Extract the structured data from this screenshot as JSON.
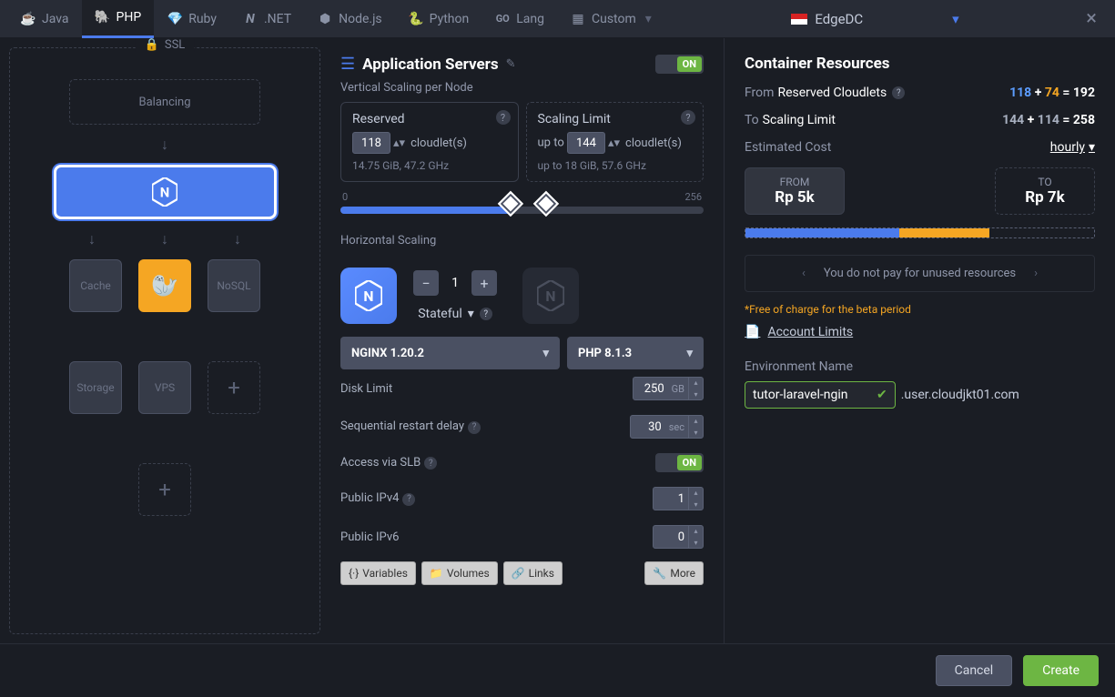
{
  "tabs": {
    "java": "Java",
    "php": "PHP",
    "ruby": "Ruby",
    "dotnet": ".NET",
    "nodejs": "Node.js",
    "python": "Python",
    "golang": "Lang",
    "custom": "Custom"
  },
  "region": "EdgeDC",
  "topology": {
    "ssl": "SSL",
    "balancing": "Balancing",
    "cache": "Cache",
    "nosql": "NoSQL",
    "storage": "Storage",
    "vps": "VPS"
  },
  "app": {
    "title": "Application Servers",
    "toggle": "ON",
    "vertical_label": "Vertical Scaling per Node",
    "reserved": {
      "title": "Reserved",
      "value": "118",
      "unit": "cloudlet(s)",
      "specs": "14.75 GiB, 47.2 GHz"
    },
    "limit": {
      "title": "Scaling Limit",
      "prefix": "up to",
      "value": "144",
      "unit": "cloudlet(s)",
      "spec_prefix": "up to",
      "specs": "18 GiB, 57.6 GHz"
    },
    "slider": {
      "min": "0",
      "max": "256"
    },
    "horizontal_label": "Horizontal Scaling",
    "count": "1",
    "mode": "Stateful",
    "server": "NGINX 1.20.2",
    "runtime": "PHP 8.1.3",
    "disk": {
      "label": "Disk Limit",
      "value": "250",
      "unit": "GB"
    },
    "delay": {
      "label": "Sequential restart delay",
      "value": "30",
      "unit": "sec"
    },
    "slb": {
      "label": "Access via SLB",
      "value": "ON"
    },
    "ipv4": {
      "label": "Public IPv4",
      "value": "1"
    },
    "ipv6": {
      "label": "Public IPv6",
      "value": "0"
    },
    "buttons": {
      "variables": "Variables",
      "volumes": "Volumes",
      "links": "Links",
      "more": "More"
    }
  },
  "resources": {
    "title": "Container Resources",
    "from": {
      "label": "From",
      "strong": "Reserved Cloudlets",
      "a": "118",
      "b": "74",
      "total": "192"
    },
    "to": {
      "label": "To",
      "strong": "Scaling Limit",
      "a": "144",
      "b": "114",
      "total": "258"
    },
    "cost_label": "Estimated Cost",
    "rate": "hourly",
    "price_from": {
      "label": "FROM",
      "value": "Rp 5k"
    },
    "price_to": {
      "label": "TO",
      "value": "Rp 7k"
    },
    "note": "You do not pay for unused resources",
    "free": "*Free of charge for the beta period",
    "limits": "Account Limits",
    "env_label": "Environment Name",
    "env_value": "tutor-laravel-ngin",
    "domain": ".user.cloudjkt01.com"
  },
  "footer": {
    "cancel": "Cancel",
    "create": "Create"
  }
}
